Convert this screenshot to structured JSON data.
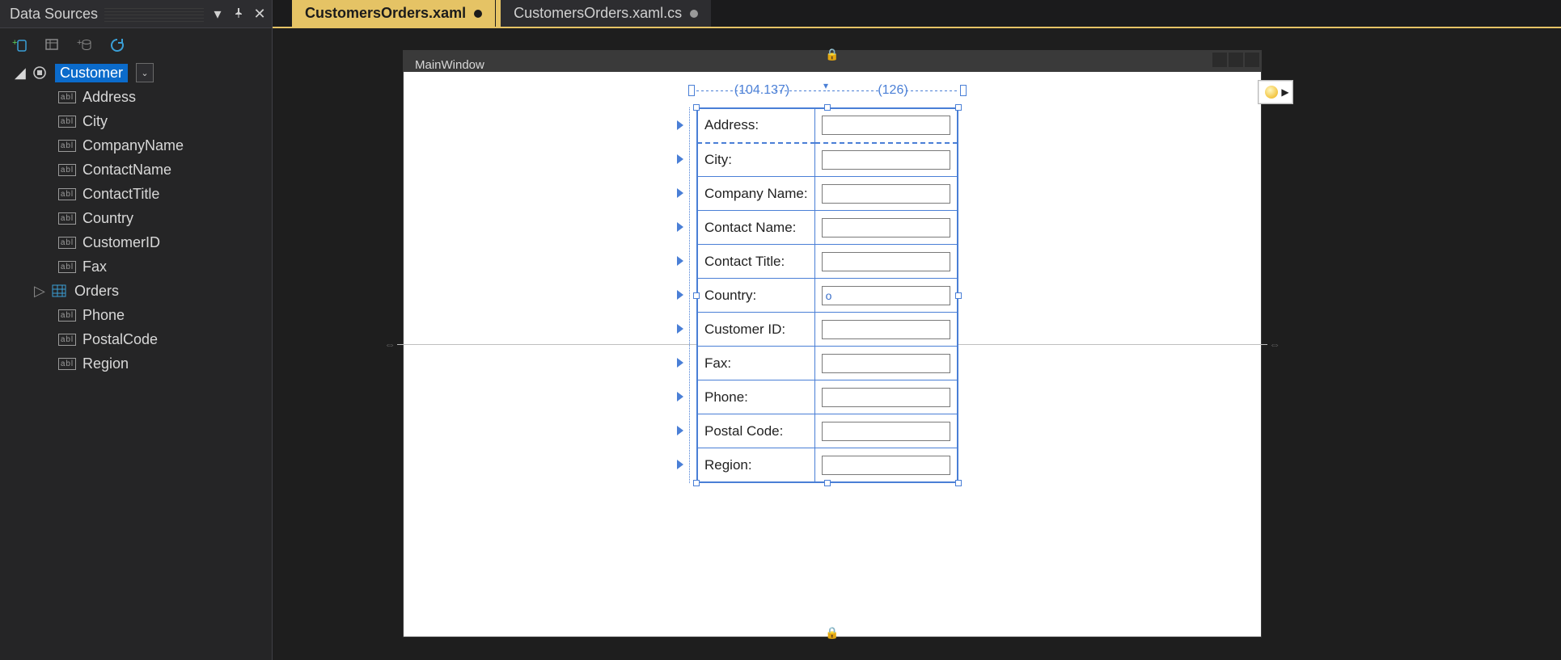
{
  "panel": {
    "title": "Data Sources",
    "toolbar": {
      "add_source": "add-data-source",
      "edit_dataset": "edit-dataset",
      "add_query": "add-query",
      "refresh": "refresh"
    },
    "root": {
      "label": "Customer",
      "expanded": true,
      "kind": "object"
    },
    "fields": [
      {
        "label": "Address",
        "kind": "text"
      },
      {
        "label": "City",
        "kind": "text"
      },
      {
        "label": "CompanyName",
        "kind": "text"
      },
      {
        "label": "ContactName",
        "kind": "text"
      },
      {
        "label": "ContactTitle",
        "kind": "text"
      },
      {
        "label": "Country",
        "kind": "text"
      },
      {
        "label": "CustomerID",
        "kind": "text"
      },
      {
        "label": "Fax",
        "kind": "text"
      },
      {
        "label": "Orders",
        "kind": "collection"
      },
      {
        "label": "Phone",
        "kind": "text"
      },
      {
        "label": "PostalCode",
        "kind": "text"
      },
      {
        "label": "Region",
        "kind": "text"
      }
    ]
  },
  "tabs": [
    {
      "label": "CustomersOrders.xaml",
      "active": true,
      "dirty": true
    },
    {
      "label": "CustomersOrders.xaml.cs",
      "active": false,
      "dirty": true
    }
  ],
  "designer": {
    "window_title": "MainWindow",
    "ruler": {
      "col1": "(104.137)",
      "col2": "(126)"
    },
    "form_rows": [
      {
        "label": "Address:",
        "value": "",
        "first": true
      },
      {
        "label": "City:",
        "value": ""
      },
      {
        "label": "Company Name:",
        "value": ""
      },
      {
        "label": "Contact Name:",
        "value": ""
      },
      {
        "label": "Contact Title:",
        "value": ""
      },
      {
        "label": "Country:",
        "value": "o"
      },
      {
        "label": "Customer ID:",
        "value": ""
      },
      {
        "label": "Fax:",
        "value": ""
      },
      {
        "label": "Phone:",
        "value": ""
      },
      {
        "label": "Postal Code:",
        "value": ""
      },
      {
        "label": "Region:",
        "value": ""
      }
    ]
  }
}
